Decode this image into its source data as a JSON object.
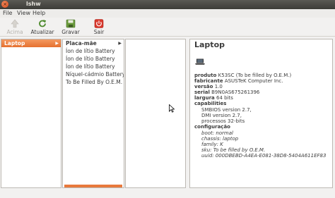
{
  "window": {
    "title": "lshw"
  },
  "menu": {
    "file": "File",
    "view": "View",
    "help": "Help"
  },
  "toolbar": {
    "up": {
      "label": "Acima",
      "icon": "up-arrow-icon",
      "enabled": false
    },
    "refresh": {
      "label": "Atualizar",
      "icon": "refresh-icon"
    },
    "save": {
      "label": "Gravar",
      "icon": "save-icon"
    },
    "quit": {
      "label": "Sair",
      "icon": "power-icon"
    }
  },
  "colors": {
    "selection": "#e8793c",
    "titlebar": "#3d3c38"
  },
  "tree": {
    "level1": [
      {
        "label": "Laptop",
        "selected": true
      }
    ],
    "level2": [
      {
        "label": "Placa-mãe",
        "expandable": true
      },
      {
        "label": "Íon de lítio Battery"
      },
      {
        "label": "Íon de lítio Battery"
      },
      {
        "label": "Íon de lítio Battery"
      },
      {
        "label": "Níquel-cádmio Battery"
      },
      {
        "label": "To Be Filled By O.E.M."
      }
    ]
  },
  "details": {
    "title": "Laptop",
    "icon": "laptop-icon",
    "product": {
      "key": "produto",
      "value": "K53SC (To be filled by O.E.M.)"
    },
    "vendor": {
      "key": "fabricante",
      "value": "ASUSTeK Computer Inc."
    },
    "version": {
      "key": "versão",
      "value": "1.0"
    },
    "serial": {
      "key": "serial",
      "value": "B9N0AS675261396"
    },
    "width": {
      "key": "largura",
      "value": "64 bits"
    },
    "capabilities": {
      "key": "capabilities",
      "items": [
        "SMBIOS version 2.7,",
        "DMI version 2.7,",
        "processos 32-bits"
      ]
    },
    "configuration": {
      "key": "configuração",
      "items": [
        "boot: normal",
        "chassis: laptop",
        "family: K",
        "sku: To be filled by O.E.M.",
        "uuid: 000DBEBD-A4EA-E081-38D8-5404A611EF83"
      ]
    }
  }
}
